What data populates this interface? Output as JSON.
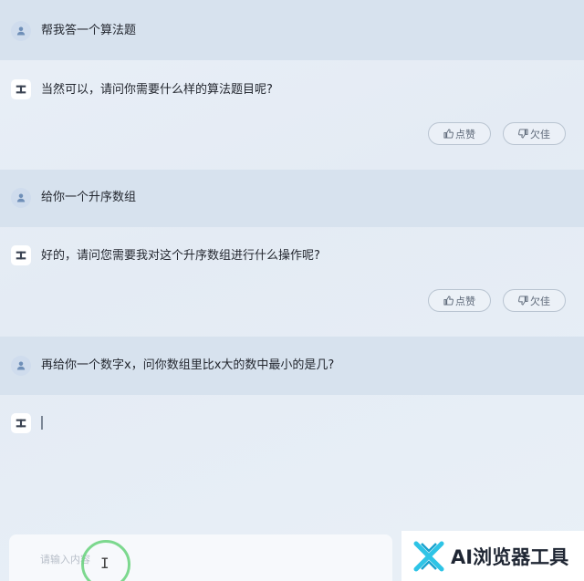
{
  "colors": {
    "user_row_bg": "#d7e2ee",
    "page_bg": "#e6edf5",
    "button_border": "#b9c4d1",
    "accent_ring": "#66d27a",
    "brand_cyan": "#2ec4e6"
  },
  "messages": [
    {
      "role": "user",
      "text": "帮我答一个算法题"
    },
    {
      "role": "assistant",
      "text": "当然可以，请问你需要什么样的算法题目呢?",
      "like_label": "点赞",
      "dislike_label": "欠佳"
    },
    {
      "role": "user",
      "text": "给你一个升序数组"
    },
    {
      "role": "assistant",
      "text": "好的，请问您需要我对这个升序数组进行什么操作呢?",
      "like_label": "点赞",
      "dislike_label": "欠佳"
    },
    {
      "role": "user",
      "text": "再给你一个数字x，问你数组里比x大的数中最小的是几?"
    },
    {
      "role": "assistant",
      "text": ""
    }
  ],
  "input": {
    "placeholder": "请输入内容",
    "value": ""
  },
  "icons": {
    "user_avatar": "person-icon",
    "bot_avatar": "bot-logo-icon",
    "like": "thumbs-up-icon",
    "dislike": "thumbs-down-icon",
    "brand_logo": "x-logo-icon"
  },
  "watermark": {
    "brand_text": "AI浏览器工具"
  }
}
